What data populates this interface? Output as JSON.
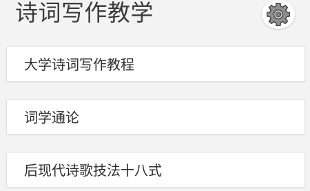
{
  "header": {
    "title": "诗词写作教学",
    "settings_icon": "gear-icon"
  },
  "list": {
    "items": [
      {
        "label": "大学诗词写作教程"
      },
      {
        "label": "词学通论"
      },
      {
        "label": "后现代诗歌技法十八式"
      }
    ]
  }
}
